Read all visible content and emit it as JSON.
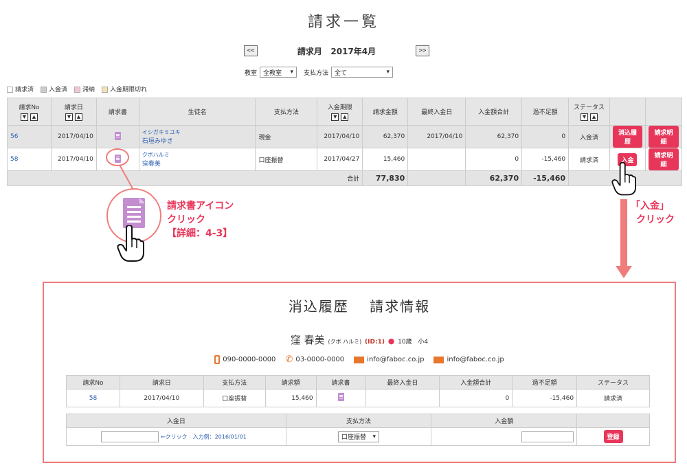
{
  "page": {
    "title": "請求一覧"
  },
  "nav": {
    "prev": "<<",
    "next": ">>",
    "month_label": "請求月",
    "month_value": "2017年4月"
  },
  "filters": {
    "school_label": "教室",
    "school_value": "全教室",
    "payment_label": "支払方法",
    "payment_value": "全て"
  },
  "legend": [
    {
      "label": "請求済",
      "color": "#ffffff"
    },
    {
      "label": "入金済",
      "color": "#cccccc"
    },
    {
      "label": "滞納",
      "color": "#f4c6d4"
    },
    {
      "label": "入金期限切れ",
      "color": "#f3e2b3"
    }
  ],
  "table": {
    "headers": [
      "請求No",
      "請求日",
      "請求書",
      "生徒名",
      "支払方法",
      "入金期限",
      "請求金額",
      "最終入金日",
      "入金額合計",
      "過不足額",
      "ステータス"
    ],
    "rows": [
      {
        "no": "56",
        "date": "2017/04/10",
        "kana": "イシガキミユキ",
        "name": "石垣みゆき",
        "method": "現金",
        "deadline": "2017/04/10",
        "amount": "62,370",
        "last_paid": "2017/04/10",
        "paid_total": "62,370",
        "diff": "0",
        "status": "入金済",
        "btn1": "消込履歴",
        "btn2": "請求明細"
      },
      {
        "no": "58",
        "date": "2017/04/10",
        "kana": "クボハルミ",
        "name": "窪春美",
        "method": "口座振替",
        "deadline": "2017/04/27",
        "amount": "15,460",
        "last_paid": "",
        "paid_total": "0",
        "diff": "-15,460",
        "status": "請求済",
        "btn1": "入金",
        "btn2": "請求明細"
      }
    ],
    "total": {
      "label": "合計",
      "amount": "77,830",
      "paid_total": "62,370",
      "diff": "-15,460"
    }
  },
  "callouts": {
    "invoice_icon": [
      "請求書アイコン",
      "クリック",
      "【詳細：4-3】"
    ],
    "payment": [
      "「入金」",
      "クリック"
    ]
  },
  "panel": {
    "title": "消込履歴　 請求情報",
    "student_name": "窪 春美",
    "student_kana": "(クボ ハルミ)",
    "student_id": "(ID:1)",
    "age": "10歳",
    "grade": "小4",
    "phone_mobile": "090-0000-0000",
    "phone": "03-0000-0000",
    "email1": "info@faboc.co.jp",
    "email2": "info@faboc.co.jp",
    "invoice_headers": [
      "請求No",
      "請求日",
      "支払方法",
      "請求額",
      "請求書",
      "最終入金日",
      "入金額合計",
      "過不足額",
      "ステータス"
    ],
    "invoice_row": {
      "no": "58",
      "date": "2017/04/10",
      "method": "口座振替",
      "amount": "15,460",
      "last_paid": "",
      "paid_total": "0",
      "diff": "-15,460",
      "status": "請求済"
    },
    "payment_headers": [
      "入金日",
      "支払方法",
      "入金額"
    ],
    "date_hint": "←クリック　入力例：2016/01/01",
    "method_value": "口座振替",
    "register_label": "登録"
  },
  "colors": {
    "accent": "#e8365a",
    "callout": "#f07c7c",
    "link": "#2a5db0"
  }
}
